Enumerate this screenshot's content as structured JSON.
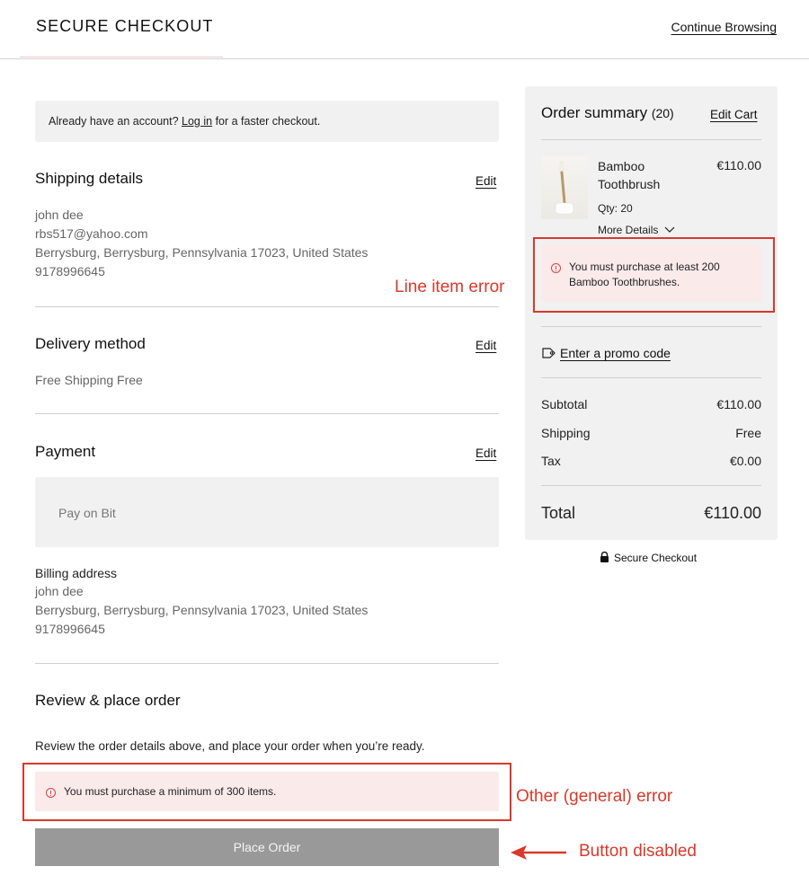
{
  "header": {
    "title": "SECURE CHECKOUT",
    "continue_link": "Continue Browsing"
  },
  "login_banner": {
    "prefix": "Already have an account? ",
    "link": "Log in",
    "suffix": " for a faster checkout."
  },
  "shipping": {
    "title": "Shipping details",
    "edit": "Edit",
    "name": "john dee",
    "email": "rbs517@yahoo.com",
    "address": "Berrysburg, Berrysburg, Pennsylvania 17023, United States",
    "phone": "9178996645"
  },
  "delivery": {
    "title": "Delivery method",
    "edit": "Edit",
    "method": "Free Shipping Free"
  },
  "payment": {
    "title": "Payment",
    "edit": "Edit",
    "method": "Pay on Bit",
    "billing_label": "Billing address",
    "billing_name": "john dee",
    "billing_address": "Berrysburg, Berrysburg, Pennsylvania 17023, United States",
    "billing_phone": "9178996645"
  },
  "review": {
    "title": "Review & place order",
    "instructions": "Review the order details above, and place your order when you’re ready.",
    "error": "You must purchase a minimum of 300 items.",
    "place_order": "Place Order"
  },
  "summary": {
    "title": "Order summary",
    "count": "(20)",
    "edit_cart": "Edit Cart",
    "item": {
      "name_line1": "Bamboo",
      "name_line2": "Toothbrush",
      "price": "€110.00",
      "qty": "Qty: 20",
      "more_details": "More Details",
      "error_line1": "You must purchase at least 200",
      "error_line2": "Bamboo Toothbrushes."
    },
    "promo": "Enter a promo code",
    "subtotal_label": "Subtotal",
    "subtotal_value": "€110.00",
    "shipping_label": "Shipping",
    "shipping_value": "Free",
    "tax_label": "Tax",
    "tax_value": "€0.00",
    "total_label": "Total",
    "total_value": "€110.00",
    "secure": "Secure Checkout"
  },
  "annotations": {
    "line_item_error": "Line item error",
    "general_error": "Other (general) error",
    "button_disabled": "Button disabled"
  },
  "colors": {
    "annotation": "#d8392b",
    "error_bg": "#fbeaea",
    "panel_bg": "#f1f1f1",
    "disabled_button": "#999999"
  }
}
